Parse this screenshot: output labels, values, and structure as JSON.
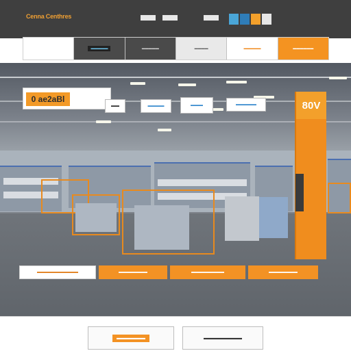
{
  "header": {
    "brand": "Cenna Centhres",
    "logo_colors": [
      "#4aa6d8",
      "#2f7db8",
      "#f3a02b",
      "#e7e7e7"
    ]
  },
  "nav": {
    "items": [
      {
        "label": "",
        "style": "blank"
      },
      {
        "label": "▬▬▬▬▬",
        "style": "dark-pill"
      },
      {
        "label": "▬▬▬▬▬",
        "style": "dark"
      },
      {
        "label": "▬▬▬▬",
        "style": "light"
      },
      {
        "label": "▬▬▬▬▬",
        "style": "accent"
      },
      {
        "label": "▬▬▬▬▬▬",
        "style": "orange"
      }
    ]
  },
  "hero": {
    "banner_text": "0 ae2aBl",
    "pillar_text": "80V",
    "cards": [
      "▬▬",
      "▬▬▬▬",
      "▬▬▬",
      "▬▬▬▬▬"
    ]
  },
  "actions": [
    {
      "label": "▬▬▬▬▬▬▬▬▬▬",
      "style": "white"
    },
    {
      "label": "▬▬▬▬▬▬▬",
      "style": "orange"
    },
    {
      "label": "▬▬▬▬▬▬▬▬",
      "style": "orange"
    },
    {
      "label": "▬▬▬▬▬▬▬",
      "style": "orange"
    }
  ],
  "footer": {
    "cards": [
      "▬▬▬▬▬▬",
      "▬▬▬▬▬▬▬▬"
    ]
  },
  "colors": {
    "accent": "#f39224",
    "header_bg": "#3f3f3f",
    "card_text_blue": "#3d8ed0"
  }
}
